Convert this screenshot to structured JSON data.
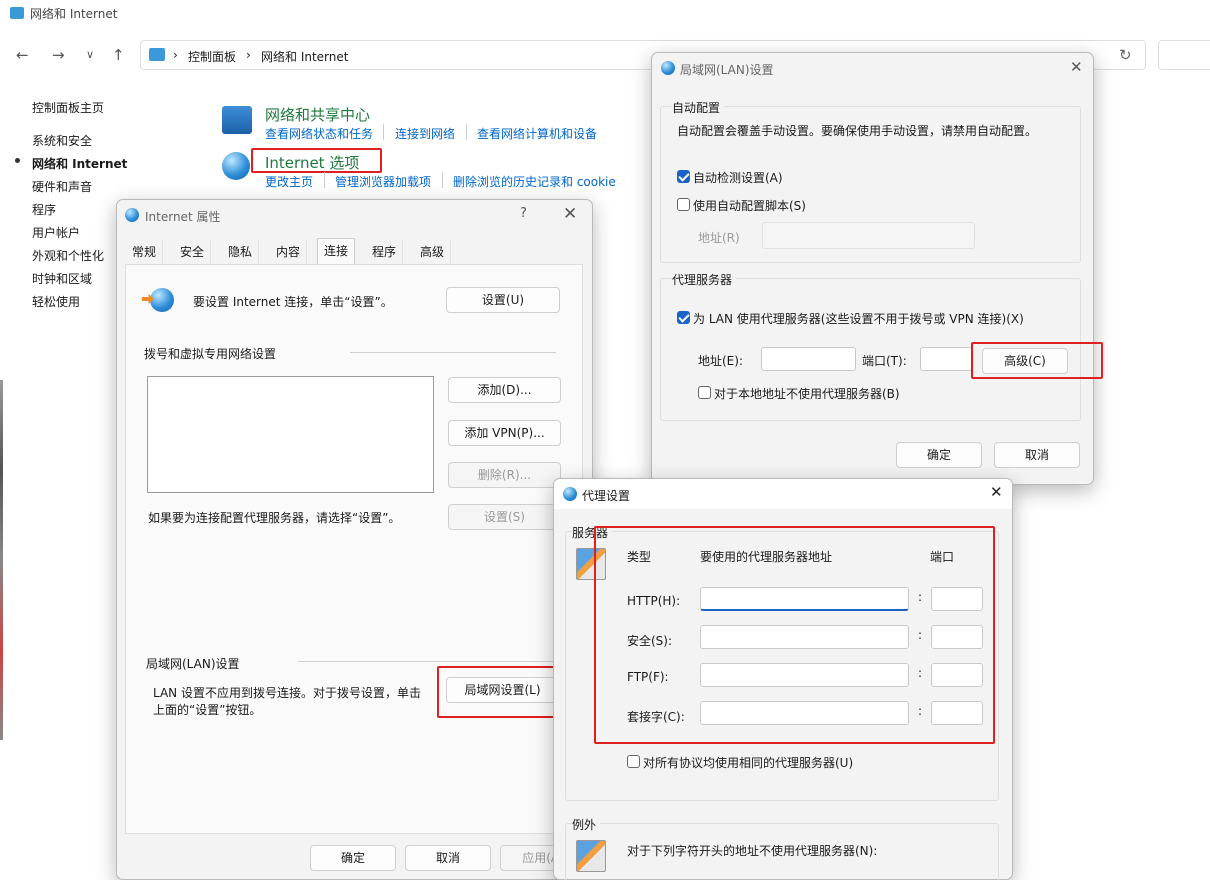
{
  "window": {
    "title": "网络和 Internet"
  },
  "breadcrumb": {
    "root": "控制面板",
    "sep": "›",
    "current": "网络和 Internet"
  },
  "left_nav": {
    "items": [
      "控制面板主页",
      "系统和安全",
      "网络和 Internet",
      "硬件和声音",
      "程序",
      "用户帐户",
      "外观和个性化",
      "时钟和区域",
      "轻松使用"
    ]
  },
  "sections": {
    "sharing": {
      "title": "网络和共享中心",
      "links": [
        "查看网络状态和任务",
        "连接到网络",
        "查看网络计算机和设备"
      ]
    },
    "internet_options": {
      "title": "Internet 选项",
      "links": [
        "更改主页",
        "管理浏览器加载项",
        "删除浏览的历史记录和 cookie"
      ]
    }
  },
  "internet_props": {
    "title": "Internet 属性",
    "help": "?",
    "tabs": [
      "常规",
      "安全",
      "隐私",
      "内容",
      "连接",
      "程序",
      "高级"
    ],
    "active_tab": "连接",
    "setup_text": "要设置 Internet 连接，单击“设置”。",
    "setup_button": "设置(U)",
    "dial_group": "拨号和虚拟专用网络设置",
    "add_button": "添加(D)...",
    "add_vpn_button": "添加 VPN(P)...",
    "remove_button": "删除(R)...",
    "settings_button": "设置(S)",
    "proxy_hint": "如果要为连接配置代理服务器，请选择“设置”。",
    "lan_group": "局域网(LAN)设置",
    "lan_text1": "LAN 设置不应用到拨号连接。对于拨号设置，单击",
    "lan_text2": "上面的“设置”按钮。",
    "lan_button": "局域网设置(L)",
    "ok": "确定",
    "cancel": "取消",
    "apply": "应用(A)"
  },
  "lan_dialog": {
    "title": "局域网(LAN)设置",
    "auto_group": "自动配置",
    "auto_desc": "自动配置会覆盖手动设置。要确保使用手动设置，请禁用自动配置。",
    "auto_detect": "自动检测设置(A)",
    "auto_detect_checked": true,
    "use_script": "使用自动配置脚本(S)",
    "use_script_checked": false,
    "script_addr_label": "地址(R)",
    "proxy_group": "代理服务器",
    "use_proxy": "为 LAN 使用代理服务器(这些设置不用于拨号或 VPN 连接)(X)",
    "use_proxy_checked": true,
    "addr_label": "地址(E):",
    "port_label": "端口(T):",
    "advanced_button": "高级(C)",
    "bypass_local": "对于本地地址不使用代理服务器(B)",
    "bypass_local_checked": false,
    "ok": "确定",
    "cancel": "取消"
  },
  "proxy_dialog": {
    "title": "代理设置",
    "servers_group": "服务器",
    "col_type": "类型",
    "col_addr": "要使用的代理服务器地址",
    "col_port": "端口",
    "rows": [
      "HTTP(H):",
      "安全(S):",
      "FTP(F):",
      "套接字(C):"
    ],
    "colon": ":",
    "same_proxy": "对所有协议均使用相同的代理服务器(U)",
    "same_proxy_checked": false,
    "exceptions_group": "例外",
    "exceptions_text": "对于下列字符开头的地址不使用代理服务器(N):"
  },
  "colors": {
    "link": "#0066cc",
    "highlight": "#e02020",
    "accent": "#1a64c8"
  }
}
